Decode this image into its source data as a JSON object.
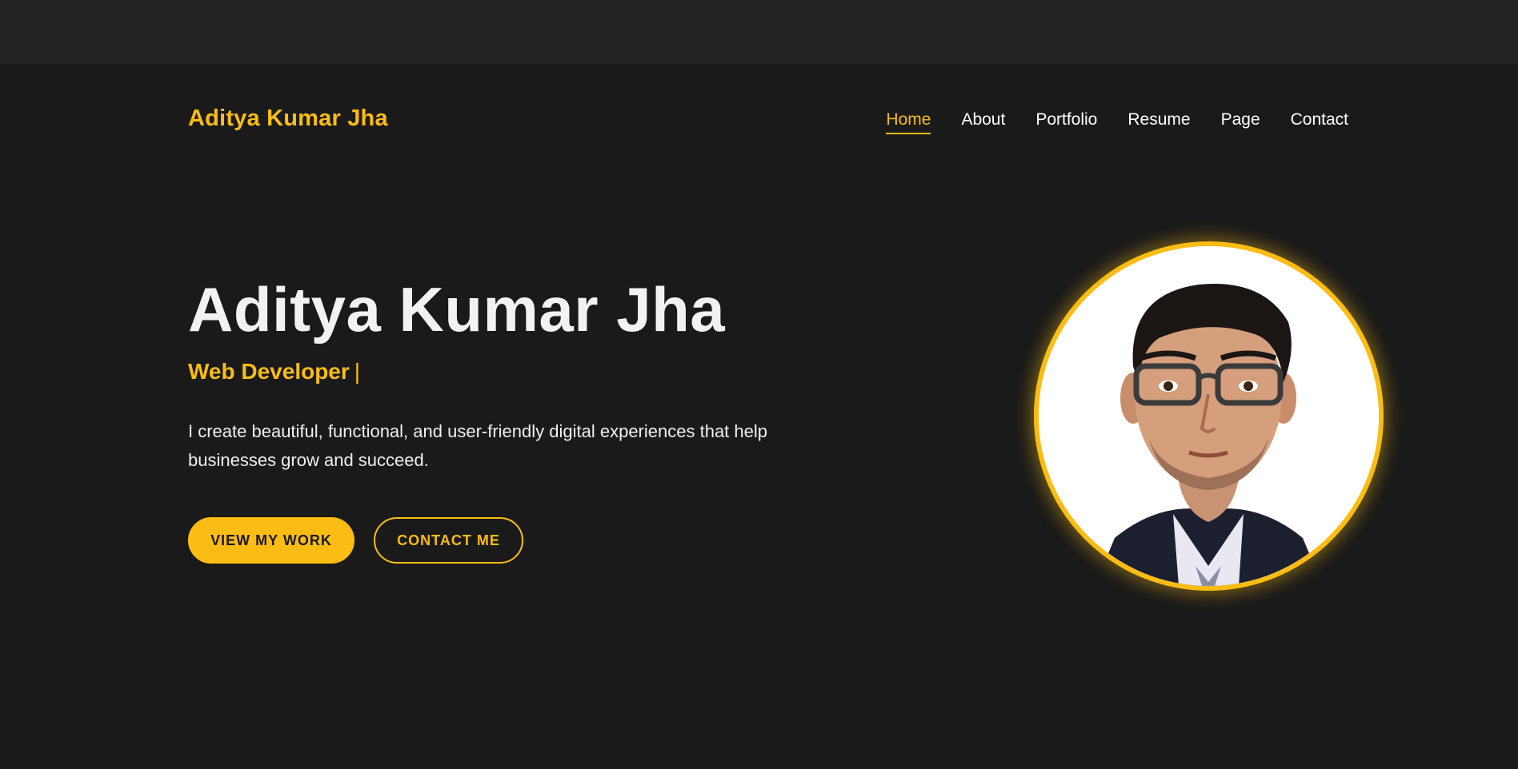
{
  "header": {
    "logo_text": "Aditya Kumar Jha",
    "nav": [
      {
        "label": "Home",
        "active": true
      },
      {
        "label": "About",
        "active": false
      },
      {
        "label": "Portfolio",
        "active": false
      },
      {
        "label": "Resume",
        "active": false
      },
      {
        "label": "Page",
        "active": false
      },
      {
        "label": "Contact",
        "active": false
      }
    ]
  },
  "hero": {
    "name": "Aditya Kumar Jha",
    "role": "Web Developer",
    "cursor": "|",
    "description": "I create beautiful, functional, and user-friendly digital experiences that help businesses grow and succeed.",
    "primary_button": "VIEW MY WORK",
    "secondary_button": "CONTACT ME",
    "avatar_icon": "profile-photo"
  },
  "colors": {
    "accent": "#fbbd13",
    "background": "#1a1a1a",
    "top_strip": "#222222",
    "text": "#ffffff"
  }
}
